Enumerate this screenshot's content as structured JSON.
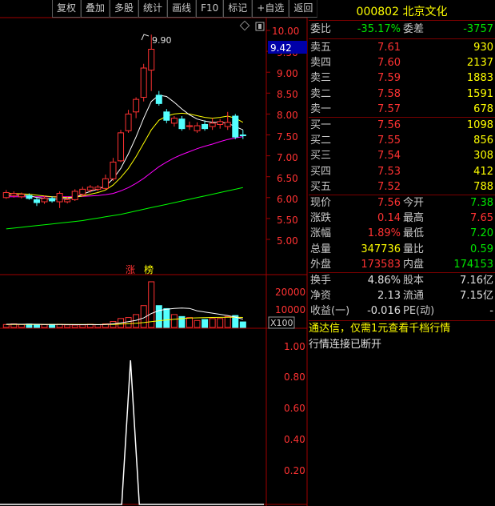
{
  "toolbar": {
    "buttons": [
      "复权",
      "叠加",
      "多股",
      "统计",
      "画线",
      "F10",
      "标记",
      "+自选",
      "返回"
    ]
  },
  "chart": {
    "price_labels": [
      "10.00",
      "9.50",
      "9.00",
      "8.50",
      "8.00",
      "7.50",
      "7.00",
      "6.50",
      "6.00",
      "5.50",
      "5.00"
    ],
    "current_price_tag": "9.42",
    "high_annotation": "9.90",
    "badge_zhang": "涨",
    "badge_bang": "榜",
    "volume_labels": [
      "20000",
      "10000"
    ],
    "volume_unit": "X100",
    "indicator_labels": [
      "1.00",
      "0.80",
      "0.60",
      "0.40",
      "0.20"
    ]
  },
  "chart_data": {
    "type": "candlestick",
    "price_axis": [
      5.0,
      10.0
    ],
    "candles": [
      {
        "o": 6.0,
        "c": 6.12,
        "h": 6.18,
        "l": 5.97
      },
      {
        "o": 6.05,
        "c": 6.1,
        "h": 6.15,
        "l": 6.0
      },
      {
        "o": 6.02,
        "c": 6.08,
        "h": 6.12,
        "l": 5.98
      },
      {
        "o": 6.05,
        "c": 5.98,
        "h": 6.1,
        "l": 5.95
      },
      {
        "o": 5.95,
        "c": 5.88,
        "h": 6.0,
        "l": 5.8
      },
      {
        "o": 5.9,
        "c": 5.98,
        "h": 6.05,
        "l": 5.85
      },
      {
        "o": 5.98,
        "c": 5.92,
        "h": 6.03,
        "l": 5.88
      },
      {
        "o": 5.9,
        "c": 6.1,
        "h": 6.15,
        "l": 5.75
      },
      {
        "o": 5.9,
        "c": 5.95,
        "h": 6.02,
        "l": 5.86
      },
      {
        "o": 5.95,
        "c": 6.15,
        "h": 6.2,
        "l": 5.92
      },
      {
        "o": 6.08,
        "c": 6.2,
        "h": 6.26,
        "l": 6.03
      },
      {
        "o": 6.18,
        "c": 6.25,
        "h": 6.3,
        "l": 6.12
      },
      {
        "o": 6.2,
        "c": 6.25,
        "h": 6.3,
        "l": 6.15
      },
      {
        "o": 6.22,
        "c": 6.45,
        "h": 6.55,
        "l": 6.18
      },
      {
        "o": 6.45,
        "c": 6.85,
        "h": 6.95,
        "l": 6.4
      },
      {
        "o": 6.88,
        "c": 7.55,
        "h": 7.62,
        "l": 6.85
      },
      {
        "o": 7.6,
        "c": 8.0,
        "h": 8.1,
        "l": 7.55
      },
      {
        "o": 8.05,
        "c": 8.35,
        "h": 8.4,
        "l": 7.9
      },
      {
        "o": 8.4,
        "c": 9.1,
        "h": 9.2,
        "l": 8.3
      },
      {
        "o": 9.05,
        "c": 9.55,
        "h": 9.9,
        "l": 8.55
      },
      {
        "o": 8.45,
        "c": 8.25,
        "h": 8.55,
        "l": 8.2
      },
      {
        "o": 8.05,
        "c": 7.85,
        "h": 8.12,
        "l": 7.78
      },
      {
        "o": 7.78,
        "c": 7.9,
        "h": 7.95,
        "l": 7.7
      },
      {
        "o": 7.88,
        "c": 7.65,
        "h": 7.95,
        "l": 7.6
      },
      {
        "o": 7.7,
        "c": 7.72,
        "h": 7.82,
        "l": 7.62
      },
      {
        "o": 7.6,
        "c": 7.72,
        "h": 7.8,
        "l": 7.55
      },
      {
        "o": 7.75,
        "c": 7.65,
        "h": 7.85,
        "l": 7.6
      },
      {
        "o": 7.7,
        "c": 7.78,
        "h": 7.9,
        "l": 7.62
      },
      {
        "o": 7.75,
        "c": 7.82,
        "h": 7.88,
        "l": 7.65
      },
      {
        "o": 7.7,
        "c": 7.8,
        "h": 8.05,
        "l": 7.62
      },
      {
        "o": 7.95,
        "c": 7.45,
        "h": 8.0,
        "l": 7.4
      },
      {
        "o": 7.5,
        "c": 7.48,
        "h": 7.62,
        "l": 7.4
      }
    ],
    "ma_short": [
      6.05,
      6.06,
      6.06,
      6.05,
      6.0,
      5.98,
      5.96,
      5.97,
      5.98,
      6.0,
      6.08,
      6.15,
      6.2,
      6.28,
      6.45,
      6.7,
      7.05,
      7.45,
      7.9,
      8.3,
      8.45,
      8.42,
      8.28,
      8.12,
      7.98,
      7.88,
      7.83,
      7.8,
      7.8,
      7.78,
      7.7,
      7.62
    ],
    "ma_mid": [
      6.1,
      6.1,
      6.09,
      6.08,
      6.06,
      6.04,
      6.02,
      6.01,
      6.0,
      6.01,
      6.04,
      6.08,
      6.12,
      6.18,
      6.3,
      6.48,
      6.7,
      6.98,
      7.3,
      7.62,
      7.85,
      7.95,
      8.0,
      8.02,
      8.0,
      7.96,
      7.92,
      7.9,
      7.92,
      7.95,
      7.9,
      7.8
    ],
    "ma_long": [
      6.02,
      6.02,
      6.02,
      6.02,
      6.02,
      6.02,
      6.02,
      6.02,
      6.02,
      6.02,
      6.03,
      6.04,
      6.05,
      6.07,
      6.1,
      6.16,
      6.24,
      6.34,
      6.46,
      6.6,
      6.74,
      6.85,
      6.95,
      7.03,
      7.1,
      7.17,
      7.23,
      7.28,
      7.34,
      7.39,
      7.43,
      7.46
    ],
    "ma_xlong": [
      5.25,
      5.27,
      5.29,
      5.31,
      5.33,
      5.35,
      5.37,
      5.39,
      5.41,
      5.43,
      5.45,
      5.48,
      5.51,
      5.54,
      5.57,
      5.6,
      5.64,
      5.68,
      5.72,
      5.76,
      5.8,
      5.84,
      5.88,
      5.92,
      5.96,
      6.0,
      6.04,
      6.08,
      6.12,
      6.16,
      6.2,
      6.24
    ],
    "volume_axis": [
      0,
      25000
    ],
    "volumes": [
      1500,
      1800,
      1500,
      1700,
      1600,
      1400,
      1500,
      1600,
      1300,
      1200,
      1300,
      1600,
      1400,
      1800,
      3000,
      4500,
      5000,
      6500,
      11000,
      23000,
      11000,
      9500,
      6500,
      5500,
      5000,
      3500,
      4000,
      4500,
      4500,
      5500,
      6000,
      2800
    ],
    "vol_ma_short": [
      1600,
      1650,
      1600,
      1650,
      1600,
      1550,
      1550,
      1550,
      1450,
      1400,
      1400,
      1450,
      1400,
      1500,
      1800,
      2300,
      2900,
      3600,
      4800,
      7000,
      8500,
      9200,
      9600,
      9800,
      9600,
      8400,
      7800,
      7200,
      6600,
      6000,
      5200,
      4200
    ],
    "vol_ma_long": [
      1500,
      1520,
      1520,
      1540,
      1550,
      1550,
      1540,
      1540,
      1520,
      1500,
      1480,
      1480,
      1470,
      1480,
      1550,
      1700,
      1880,
      2100,
      2450,
      2950,
      3400,
      3800,
      4150,
      4450,
      4700,
      4850,
      4950,
      5050,
      5100,
      5150,
      5150,
      5050
    ],
    "indicator_axis": [
      0,
      1.2
    ],
    "indicator_peak": {
      "index": 19,
      "value": 1.0
    }
  },
  "quote": {
    "code": "000802",
    "name": "北京文化",
    "weibi_label": "委比",
    "weibi_value": "-35.17%",
    "weicha_label": "委差",
    "weicha_value": "-3757",
    "asks": [
      {
        "label": "卖五",
        "price": "7.61",
        "vol": "930"
      },
      {
        "label": "卖四",
        "price": "7.60",
        "vol": "2137"
      },
      {
        "label": "卖三",
        "price": "7.59",
        "vol": "1883"
      },
      {
        "label": "卖二",
        "price": "7.58",
        "vol": "1591"
      },
      {
        "label": "卖一",
        "price": "7.57",
        "vol": "678"
      }
    ],
    "bids": [
      {
        "label": "买一",
        "price": "7.56",
        "vol": "1098"
      },
      {
        "label": "买二",
        "price": "7.55",
        "vol": "856"
      },
      {
        "label": "买三",
        "price": "7.54",
        "vol": "308"
      },
      {
        "label": "买四",
        "price": "7.53",
        "vol": "412"
      },
      {
        "label": "买五",
        "price": "7.52",
        "vol": "788"
      }
    ],
    "stats": [
      {
        "l1": "现价",
        "v1": "7.56",
        "c1": "red",
        "l2": "今开",
        "v2": "7.38",
        "c2": "green"
      },
      {
        "l1": "涨跌",
        "v1": "0.14",
        "c1": "red",
        "l2": "最高",
        "v2": "7.65",
        "c2": "red"
      },
      {
        "l1": "涨幅",
        "v1": "1.89%",
        "c1": "red",
        "l2": "最低",
        "v2": "7.20",
        "c2": "green"
      },
      {
        "l1": "总量",
        "v1": "347736",
        "c1": "yellow",
        "l2": "量比",
        "v2": "0.59",
        "c2": "green"
      },
      {
        "l1": "外盘",
        "v1": "173583",
        "c1": "red",
        "l2": "内盘",
        "v2": "174153",
        "c2": "green"
      }
    ],
    "fund": [
      {
        "l1": "换手",
        "v1": "4.86%",
        "l2": "股本",
        "v2": "7.16亿"
      },
      {
        "l1": "净资",
        "v1": "2.13",
        "l2": "流通",
        "v2": "7.15亿"
      },
      {
        "l1": "收益(一)",
        "v1": "-0.016",
        "l2": "PE(动)",
        "v2": "-"
      }
    ],
    "news": "通达信，仅需1元查看千档行情",
    "status": "行情连接已断开"
  },
  "colors": {
    "up": "#ff3232",
    "down": "#54ffff",
    "ma_short": "#ffffff",
    "ma_mid": "#ffff00",
    "ma_long": "#ff00ff",
    "ma_xlong": "#00ff00",
    "grid": "#a00000"
  }
}
